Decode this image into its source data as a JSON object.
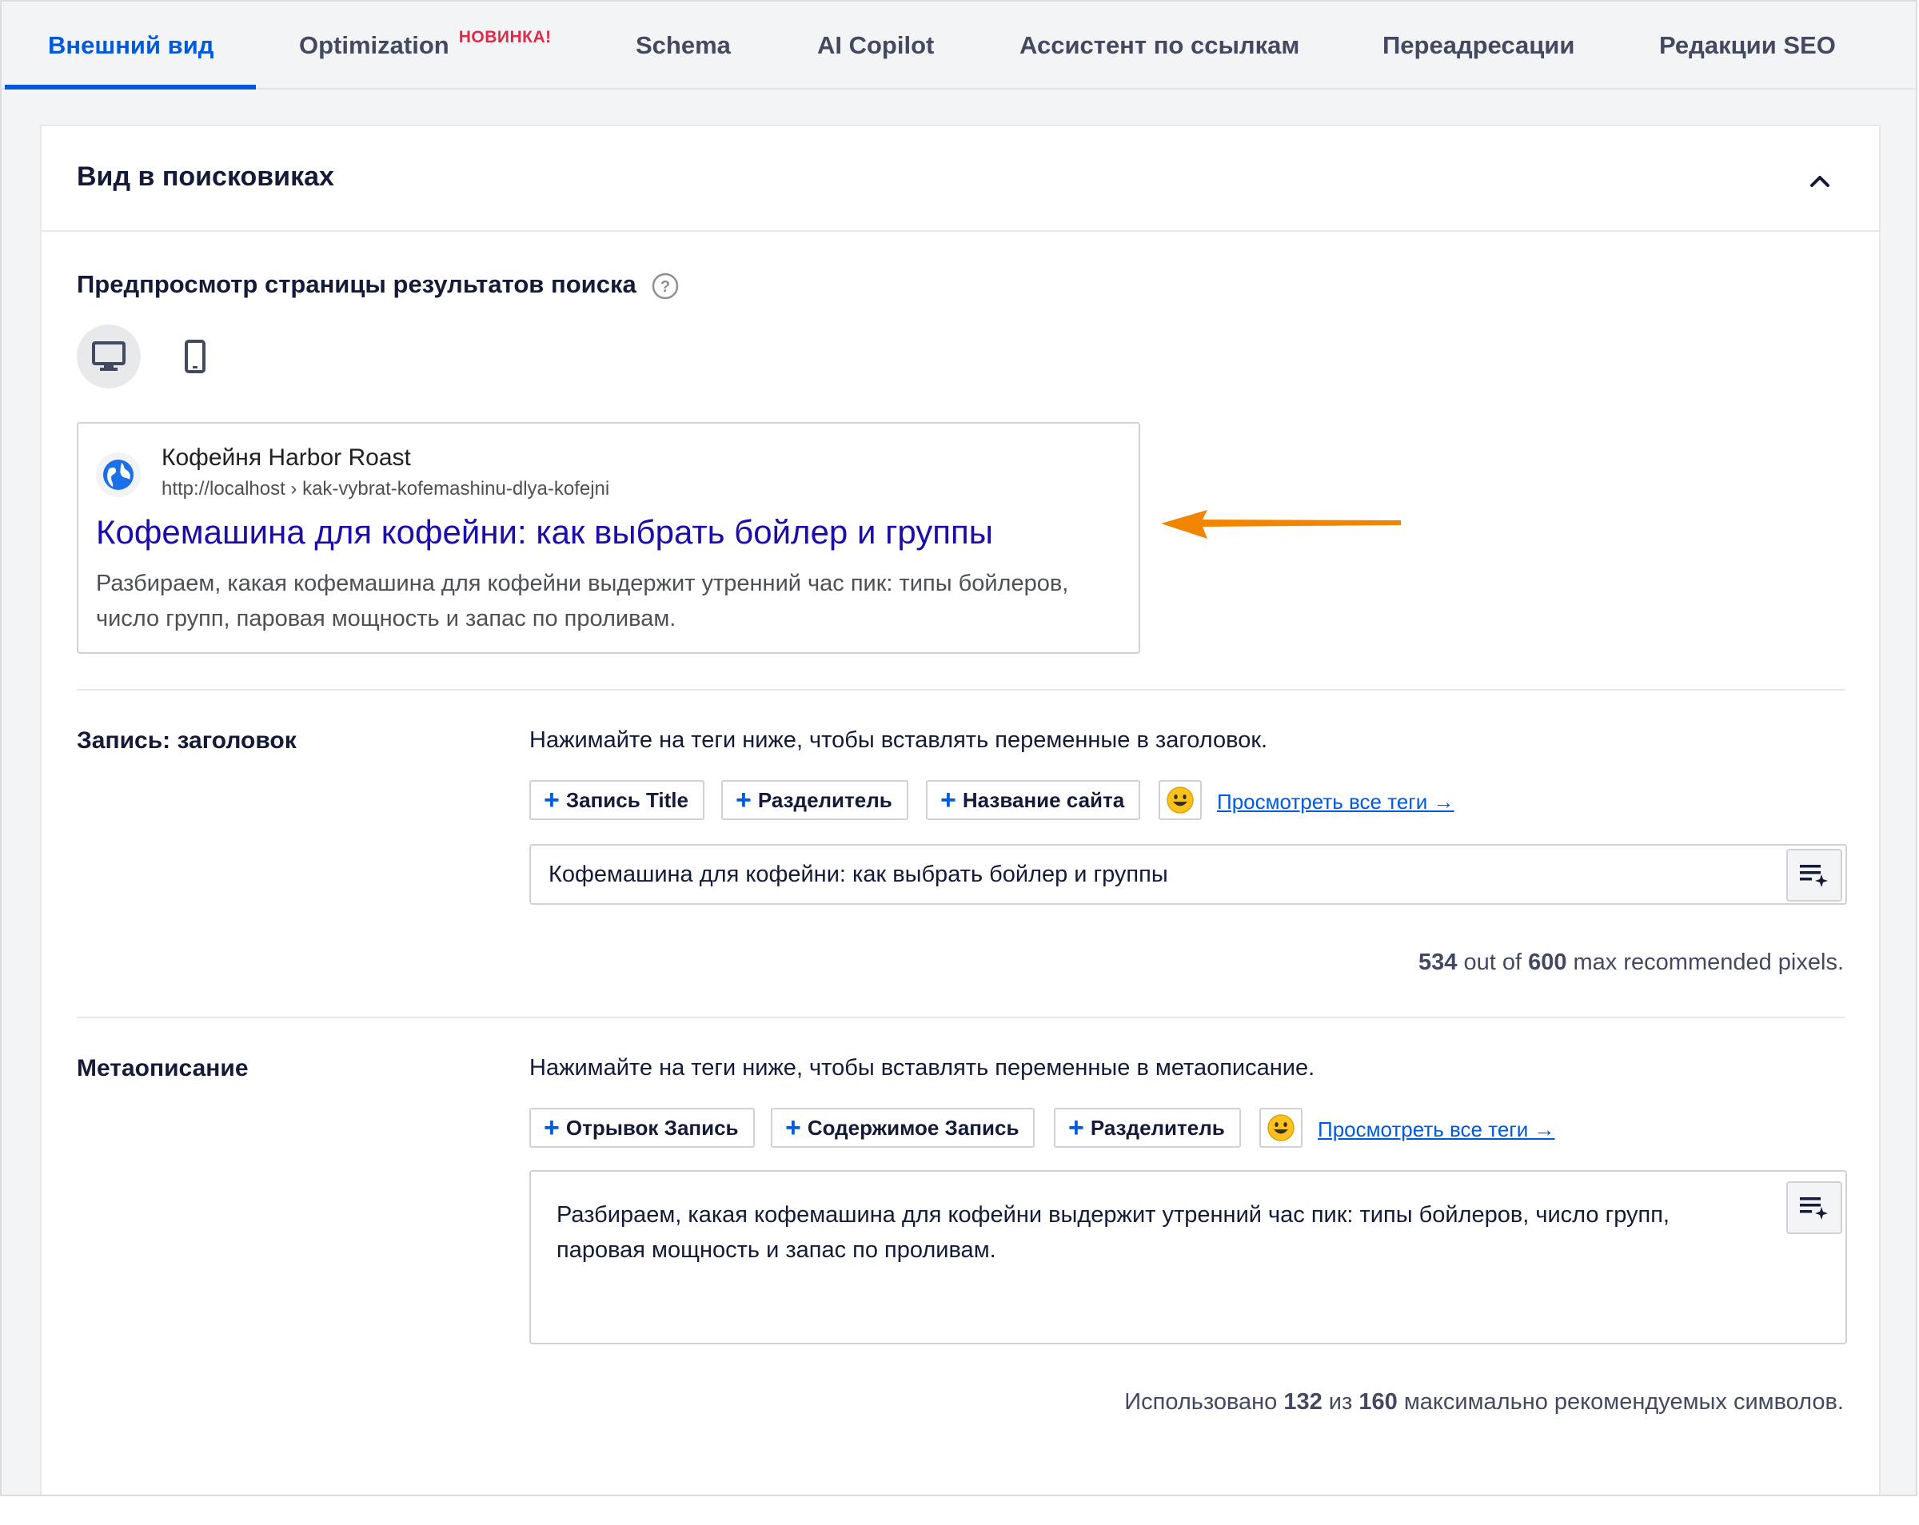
{
  "tabs": [
    {
      "label": "Внешний вид",
      "active": true
    },
    {
      "label": "Optimization",
      "badge": "НОВИНКА!"
    },
    {
      "label": "Schema"
    },
    {
      "label": "AI Copilot"
    },
    {
      "label": "Ассистент по ссылкам"
    },
    {
      "label": "Переадресации"
    },
    {
      "label": "Редакции SEO"
    }
  ],
  "panel": {
    "title": "Вид в поисковиках",
    "preview_label": "Предпросмотр страницы результатов поиска",
    "device_icons": [
      "desktop-icon",
      "mobile-icon"
    ],
    "active_device": "desktop"
  },
  "serp": {
    "site_name": "Кофейня Harbor Roast",
    "url": "http://localhost › kak-vybrat-kofemashinu-dlya-kofejni",
    "title": "Кофемашина для кофейни: как выбрать бойлер и группы",
    "description": "Разбираем, какая кофемашина для кофейни выдержит утренний час пик: типы бойлеров, число групп, паровая мощность и запас по проливам."
  },
  "post_title": {
    "label": "Запись: заголовок",
    "hint": "Нажимайте на теги ниже, чтобы вставлять переменные в заголовок.",
    "tags": [
      "Запись Title",
      "Разделитель",
      "Название сайта"
    ],
    "view_all": "Просмотреть все теги →",
    "value": "Кофемашина для кофейни: как выбрать бойлер и группы",
    "counter": {
      "used": "534",
      "mid": " out of ",
      "max": "600",
      "suffix": " max recommended pixels."
    }
  },
  "meta_description": {
    "label": "Метаописание",
    "hint": "Нажимайте на теги ниже, чтобы вставлять переменные в метаописание.",
    "tags": [
      "Отрывок Запись",
      "Содержимое Запись",
      "Разделитель"
    ],
    "view_all": "Просмотреть все теги →",
    "value": "Разбираем, какая кофемашина для кофейни выдержит утренний час пик: типы бойлеров, число групп, паровая мощность и запас по проливам.",
    "counter": {
      "prefix": "Использовано ",
      "used": "132",
      "mid": " из ",
      "max": "160",
      "suffix": " максимально рекомендуемых символов."
    }
  },
  "colors": {
    "accent": "#005ae0",
    "badge": "#df2a4a",
    "serp_title": "#1a0dab",
    "arrow": "#f18500"
  }
}
